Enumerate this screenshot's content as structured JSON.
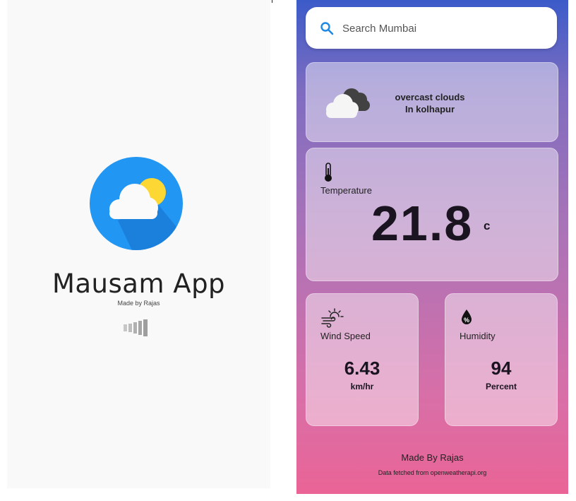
{
  "splash": {
    "app_title": "Mausam App",
    "made_by": "Made by Rajas",
    "logo_icon": "weather-logo-icon",
    "loader_icon": "loading-bars-icon"
  },
  "weather": {
    "search": {
      "placeholder": "Search Mumbai",
      "icon": "search-icon"
    },
    "condition": {
      "description": "overcast clouds",
      "location": "In kolhapur",
      "icon": "overcast-cloud-icon"
    },
    "temperature": {
      "label": "Temperature",
      "value": "21.8",
      "unit": "c",
      "icon": "thermometer-icon"
    },
    "wind": {
      "label": "Wind Speed",
      "value": "6.43",
      "unit": "km/hr",
      "icon": "wind-sun-icon"
    },
    "humidity": {
      "label": "Humidity",
      "value": "94",
      "unit": "Percent",
      "icon": "humidity-drop-icon"
    },
    "footer": {
      "made_by": "Made By Rajas",
      "source": "Data fetched from openweatherapi.org"
    }
  },
  "colors": {
    "logo_blue": "#2196f3",
    "sun_yellow": "#fdd835",
    "gradient_top": "#3b5bc9",
    "gradient_bottom": "#ea6496",
    "search_icon_blue": "#1e88e5"
  }
}
